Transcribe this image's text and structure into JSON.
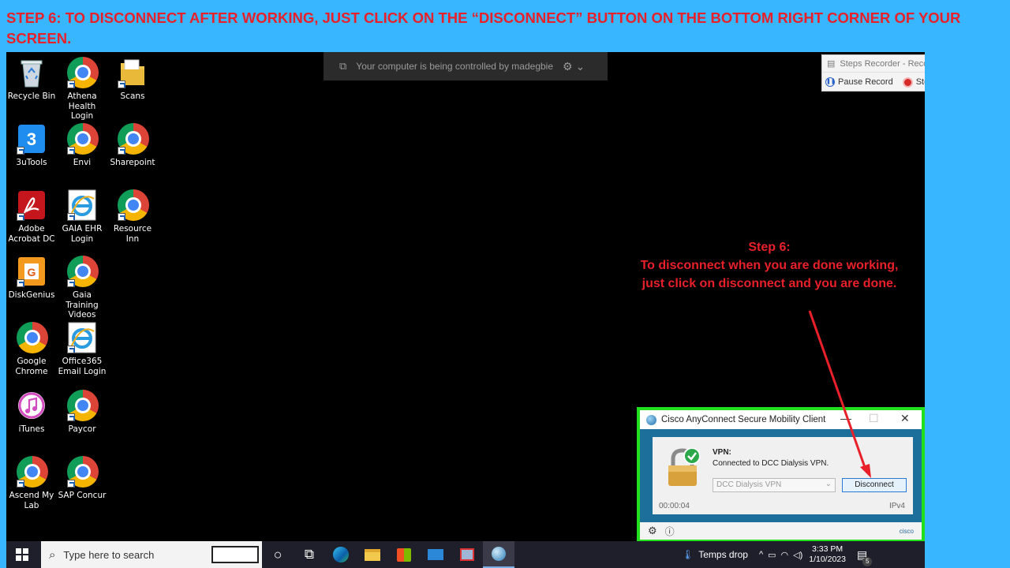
{
  "banner": {
    "text": "STEP 6: TO DISCONNECT AFTER WORKING, JUST CLICK ON THE “DISCONNECT” BUTTON ON THE BOTTOM RIGHT CORNER OF YOUR SCREEN."
  },
  "desktop_icons": [
    {
      "label": "Recycle Bin",
      "icon": "recycle-bin-icon"
    },
    {
      "label": "Athena Health Login",
      "icon": "chrome-icon"
    },
    {
      "label": "Scans",
      "icon": "folder-icon"
    },
    {
      "label": "3uTools",
      "icon": "3utools-icon"
    },
    {
      "label": "Envi",
      "icon": "chrome-icon"
    },
    {
      "label": "Sharepoint",
      "icon": "chrome-icon"
    },
    {
      "label": "Adobe Acrobat DC",
      "icon": "acrobat-icon"
    },
    {
      "label": "GAIA EHR Login",
      "icon": "internet-explorer-icon"
    },
    {
      "label": "Resource Inn",
      "icon": "chrome-icon"
    },
    {
      "label": "DiskGenius",
      "icon": "diskgenius-icon"
    },
    {
      "label": "Gaia Training Videos",
      "icon": "chrome-icon"
    },
    {
      "label": "Google Chrome",
      "icon": "chrome-icon"
    },
    {
      "label": "Office365 Email Login",
      "icon": "internet-explorer-icon"
    },
    {
      "label": "iTunes",
      "icon": "itunes-icon"
    },
    {
      "label": "Paycor",
      "icon": "chrome-icon"
    },
    {
      "label": "Ascend My Lab",
      "icon": "chrome-icon"
    },
    {
      "label": "SAP Concur",
      "icon": "chrome-icon"
    }
  ],
  "remote_bar": {
    "text": "Your computer is being controlled by madegbie"
  },
  "steps_recorder": {
    "title": "Steps Recorder - Record",
    "pause_label": "Pause Record",
    "stop_label": "Stop"
  },
  "annotation": {
    "heading": "Step 6:",
    "body": "To disconnect when you are done working, just click on disconnect and you are done."
  },
  "vpn_window": {
    "title": "Cisco AnyConnect Secure Mobility Client",
    "section_label": "VPN:",
    "status": "Connected to DCC Dialysis VPN.",
    "selected_profile": "DCC Dialysis VPN",
    "disconnect_label": "Disconnect",
    "timer": "00:00:04",
    "protocol": "IPv4",
    "brand": "cisco",
    "accent_color": "#22e01e"
  },
  "taskbar": {
    "search_placeholder": "Type here to search",
    "weather": "Temps drop",
    "time": "3:33 PM",
    "date": "1/10/2023",
    "notification_count": "5"
  },
  "colors": {
    "banner_text": "#e8202a",
    "background": "#38b6ff",
    "arrow": "#e8202a"
  }
}
